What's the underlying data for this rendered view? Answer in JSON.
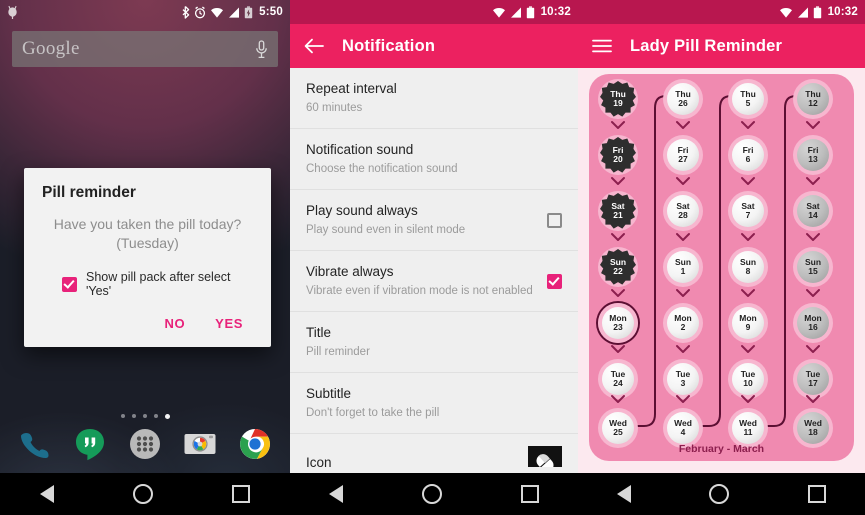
{
  "colors": {
    "accent_pink": "#e8227a",
    "appbar_pink": "#ec2160",
    "statusbar_pink": "#b8174f",
    "pack_pink": "#f08ab0",
    "pack_bg": "#fce9ef",
    "caption_pink": "#8c1f4e",
    "taken_dark": "#2e2e2e"
  },
  "home_screen": {
    "statusbar": {
      "time": "5:50",
      "icons": [
        "bluetooth-icon",
        "alarm-icon",
        "wifi-icon",
        "signal-icon",
        "battery-charging-icon"
      ]
    },
    "search_widget": {
      "text": "Google",
      "mic_icon": "microphone-icon"
    },
    "dialog": {
      "title": "Pill reminder",
      "message": "Have you taken the pill today? (Tuesday)",
      "checkbox_label": "Show pill pack after select 'Yes'",
      "checkbox_checked": true,
      "buttons": [
        "NO",
        "YES"
      ]
    },
    "page_dots": {
      "count": 5,
      "active_index": 4
    },
    "dock": [
      {
        "name": "phone-icon",
        "label": "Phone"
      },
      {
        "name": "hangouts-icon",
        "label": "Hangouts"
      },
      {
        "name": "app-drawer-icon",
        "label": "Apps"
      },
      {
        "name": "camera-icon",
        "label": "Camera"
      },
      {
        "name": "chrome-icon",
        "label": "Chrome"
      }
    ],
    "navbar": [
      "back-icon",
      "home-icon",
      "recents-icon"
    ]
  },
  "notification_settings": {
    "statusbar": {
      "time": "10:32",
      "icons": [
        "wifi-icon",
        "signal-icon",
        "battery-icon"
      ]
    },
    "appbar": {
      "title": "Notification",
      "back_icon": "back-arrow-icon"
    },
    "rows": [
      {
        "title": "Repeat interval",
        "subtitle": "60 minutes",
        "control": "none"
      },
      {
        "title": "Notification sound",
        "subtitle": "Choose the notification sound",
        "control": "none"
      },
      {
        "title": "Play sound always",
        "subtitle": "Play sound even in silent mode",
        "control": "checkbox",
        "checked": false
      },
      {
        "title": "Vibrate always",
        "subtitle": "Vibrate even if vibration mode is not enabled",
        "control": "checkbox",
        "checked": true
      },
      {
        "title": "Title",
        "subtitle": "Pill reminder",
        "control": "none"
      },
      {
        "title": "Subtitle",
        "subtitle": "Don't forget to take the pill",
        "control": "none"
      },
      {
        "title": "Icon",
        "subtitle": "",
        "control": "icon",
        "icon": "pill-capsule-icon"
      }
    ],
    "navbar": [
      "back-icon",
      "home-icon",
      "recents-icon"
    ]
  },
  "pill_pack": {
    "statusbar": {
      "time": "10:32",
      "icons": [
        "wifi-icon",
        "signal-icon",
        "battery-icon"
      ]
    },
    "appbar": {
      "title": "Lady Pill Reminder",
      "menu_icon": "hamburger-menu-icon"
    },
    "caption": "February - March",
    "columns": [
      {
        "state": "taken",
        "pills": [
          {
            "day": "Thu",
            "date": "19",
            "state": "taken"
          },
          {
            "day": "Fri",
            "date": "20",
            "state": "taken"
          },
          {
            "day": "Sat",
            "date": "21",
            "state": "taken"
          },
          {
            "day": "Sun",
            "date": "22",
            "state": "taken"
          },
          {
            "day": "Mon",
            "date": "23",
            "state": "today"
          },
          {
            "day": "Tue",
            "date": "24",
            "state": "white"
          },
          {
            "day": "Wed",
            "date": "25",
            "state": "white"
          }
        ]
      },
      {
        "state": "upcoming",
        "pills": [
          {
            "day": "Thu",
            "date": "26",
            "state": "white"
          },
          {
            "day": "Fri",
            "date": "27",
            "state": "white"
          },
          {
            "day": "Sat",
            "date": "28",
            "state": "white"
          },
          {
            "day": "Sun",
            "date": "1",
            "state": "white"
          },
          {
            "day": "Mon",
            "date": "2",
            "state": "white"
          },
          {
            "day": "Tue",
            "date": "3",
            "state": "white"
          },
          {
            "day": "Wed",
            "date": "4",
            "state": "white"
          }
        ]
      },
      {
        "state": "upcoming",
        "pills": [
          {
            "day": "Thu",
            "date": "5",
            "state": "white"
          },
          {
            "day": "Fri",
            "date": "6",
            "state": "white"
          },
          {
            "day": "Sat",
            "date": "7",
            "state": "white"
          },
          {
            "day": "Sun",
            "date": "8",
            "state": "white"
          },
          {
            "day": "Mon",
            "date": "9",
            "state": "white"
          },
          {
            "day": "Tue",
            "date": "10",
            "state": "white"
          },
          {
            "day": "Wed",
            "date": "11",
            "state": "white"
          }
        ]
      },
      {
        "state": "placebo",
        "pills": [
          {
            "day": "Thu",
            "date": "12",
            "state": "gray"
          },
          {
            "day": "Fri",
            "date": "13",
            "state": "gray"
          },
          {
            "day": "Sat",
            "date": "14",
            "state": "gray"
          },
          {
            "day": "Sun",
            "date": "15",
            "state": "gray"
          },
          {
            "day": "Mon",
            "date": "16",
            "state": "gray"
          },
          {
            "day": "Tue",
            "date": "17",
            "state": "gray"
          },
          {
            "day": "Wed",
            "date": "18",
            "state": "gray"
          }
        ]
      }
    ],
    "navbar": [
      "back-icon",
      "home-icon",
      "recents-icon"
    ]
  }
}
